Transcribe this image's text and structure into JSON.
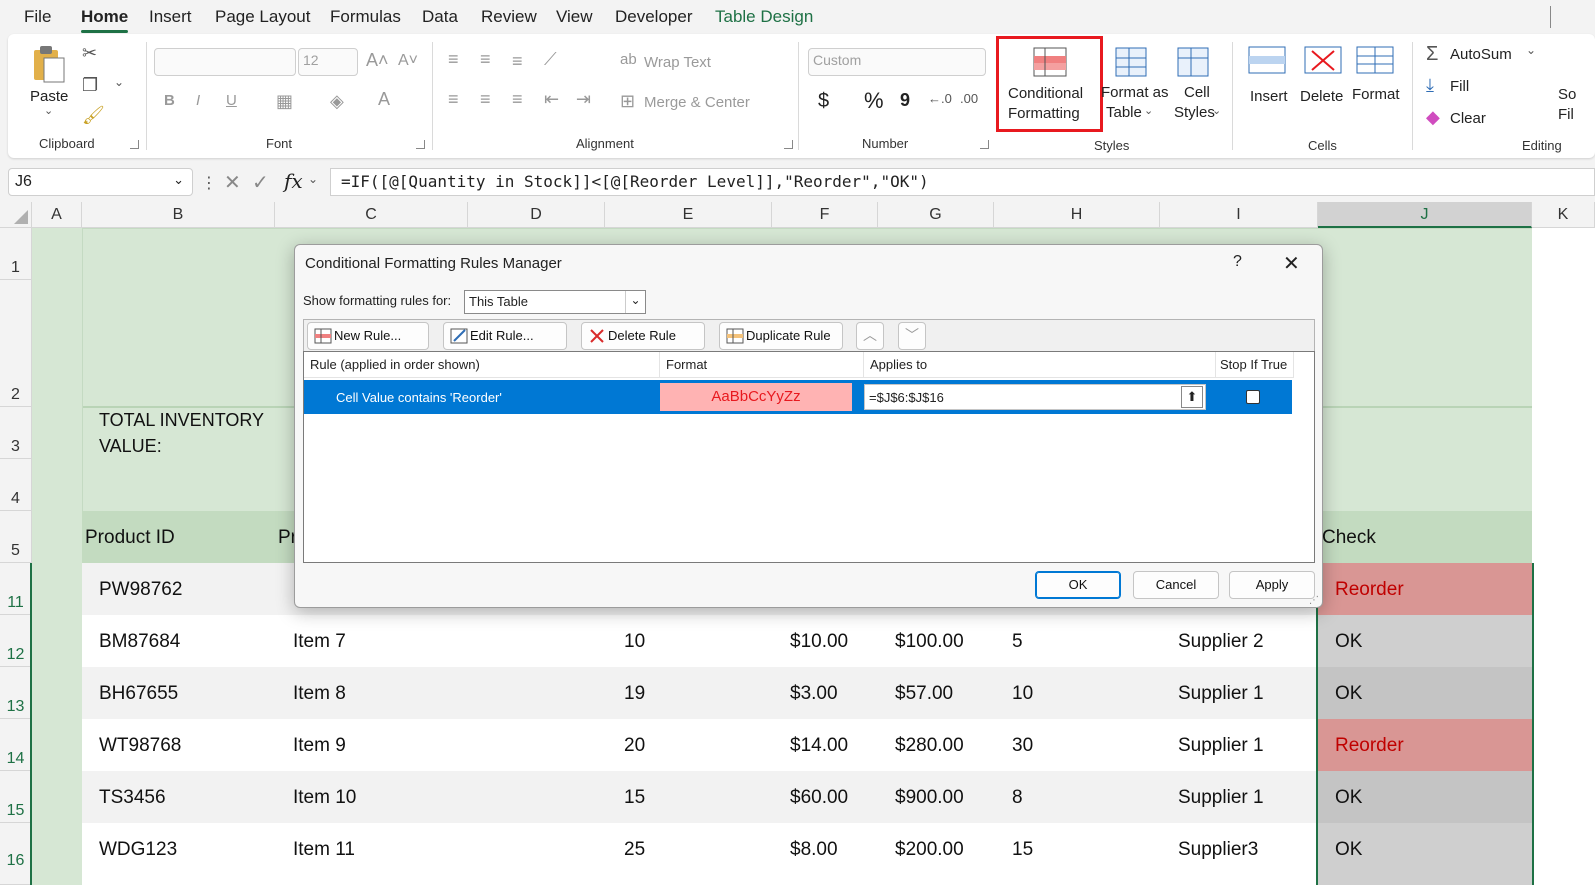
{
  "menu": {
    "tabs": [
      "File",
      "Home",
      "Insert",
      "Page Layout",
      "Formulas",
      "Data",
      "Review",
      "View",
      "Developer",
      "Table Design"
    ],
    "active": "Home"
  },
  "ribbon": {
    "clipboard": {
      "label": "Clipboard",
      "paste": "Paste"
    },
    "font": {
      "label": "Font",
      "size": "12",
      "bold": "B",
      "italic": "I",
      "underline": "U"
    },
    "alignment": {
      "label": "Alignment",
      "wrap": "Wrap Text",
      "merge": "Merge & Center"
    },
    "number": {
      "label": "Number",
      "format": "Custom",
      "currency": "$",
      "percent": "%",
      "comma": "9"
    },
    "styles": {
      "label": "Styles",
      "cond_line1": "Conditional",
      "cond_line2": "Formatting",
      "fat_line1": "Format as",
      "fat_line2": "Table",
      "cs_line1": "Cell",
      "cs_line2": "Styles"
    },
    "cells": {
      "label": "Cells",
      "insert": "Insert",
      "delete": "Delete",
      "format": "Format"
    },
    "editing": {
      "label": "Editing",
      "autosum": "AutoSum",
      "fill": "Fill",
      "clear": "Clear",
      "partial1": "So",
      "partial2": "Fil"
    }
  },
  "formula_bar": {
    "name_box": "J6",
    "fx": "fx",
    "formula": "=IF([@[Quantity in Stock]]<[@[Reorder Level]],\"Reorder\",\"OK\")"
  },
  "columns": [
    "A",
    "B",
    "C",
    "D",
    "E",
    "F",
    "G",
    "H",
    "I",
    "J",
    "K"
  ],
  "rows": [
    "1",
    "2",
    "3",
    "4",
    "5",
    "11",
    "12",
    "13",
    "14",
    "15",
    "16"
  ],
  "sheet": {
    "total_label_line1": "TOTAL INVENTORY",
    "total_label_line2": "VALUE:",
    "header_product_id": "Product ID",
    "header_partial": "Pr",
    "header_check": "Check",
    "data_rows": [
      {
        "id": "PW98762",
        "item": "",
        "qty": "",
        "price": "",
        "value": "",
        "reorder": "",
        "supplier": "",
        "check": "Reorder"
      },
      {
        "id": "BM87684",
        "item": "Item 7",
        "qty": "10",
        "price": "$10.00",
        "value": "$100.00",
        "reorder": "5",
        "supplier": "Supplier 2",
        "check": "OK"
      },
      {
        "id": "BH67655",
        "item": "Item 8",
        "qty": "19",
        "price": "$3.00",
        "value": "$57.00",
        "reorder": "10",
        "supplier": "Supplier 1",
        "check": "OK"
      },
      {
        "id": "WT98768",
        "item": "Item 9",
        "qty": "20",
        "price": "$14.00",
        "value": "$280.00",
        "reorder": "30",
        "supplier": "Supplier 1",
        "check": "Reorder"
      },
      {
        "id": "TS3456",
        "item": "Item 10",
        "qty": "15",
        "price": "$60.00",
        "value": "$900.00",
        "reorder": "8",
        "supplier": "Supplier 1",
        "check": "OK"
      },
      {
        "id": "WDG123",
        "item": "Item 11",
        "qty": "25",
        "price": "$8.00",
        "value": "$200.00",
        "reorder": "15",
        "supplier": "Supplier3",
        "check": "OK"
      }
    ]
  },
  "dialog": {
    "title": "Conditional Formatting Rules Manager",
    "help": "?",
    "show_label": "Show formatting rules for:",
    "show_value": "This Table",
    "buttons": {
      "new": "New Rule...",
      "edit": "Edit Rule...",
      "delete": "Delete Rule",
      "duplicate": "Duplicate Rule"
    },
    "columns": {
      "rule": "Rule (applied in order shown)",
      "format": "Format",
      "applies": "Applies to",
      "stop": "Stop If True"
    },
    "rule": {
      "text": "Cell Value contains 'Reorder'",
      "format_preview": "AaBbCcYyZz",
      "applies_to": "=$J$6:$J$16"
    },
    "ok": "OK",
    "cancel": "Cancel",
    "apply": "Apply"
  },
  "colors": {
    "excel_green": "#1e7145",
    "table_green": "#d6e7d4",
    "reorder_fill": "#d99694",
    "reorder_text": "#c00000",
    "select_blue": "#0078d4",
    "highlight_red": "#e8191f"
  }
}
